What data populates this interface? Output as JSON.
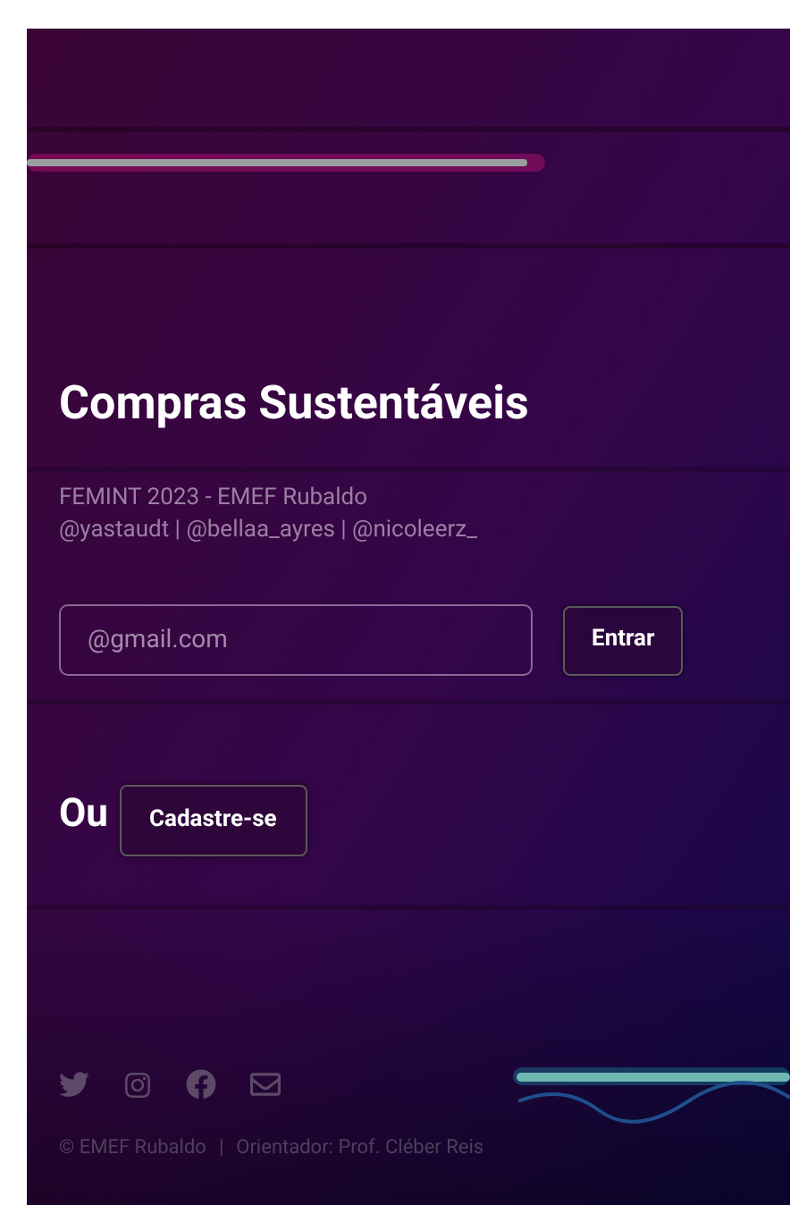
{
  "title": "Compras Sustentáveis",
  "subtitle_lines": [
    "FEMINT 2023 - EMEF Rubaldo",
    "@yastaudt | @bellaa_ayres | @nicoleerz_"
  ],
  "email_field": {
    "placeholder": "@gmail.com"
  },
  "login_button": "Entrar",
  "or_label": "Ou",
  "signup_button": "Cadastre-se",
  "footer": {
    "copyright": "© EMEF Rubaldo",
    "separator": "|",
    "credit": "Orientador: Prof. Cléber Reis"
  }
}
